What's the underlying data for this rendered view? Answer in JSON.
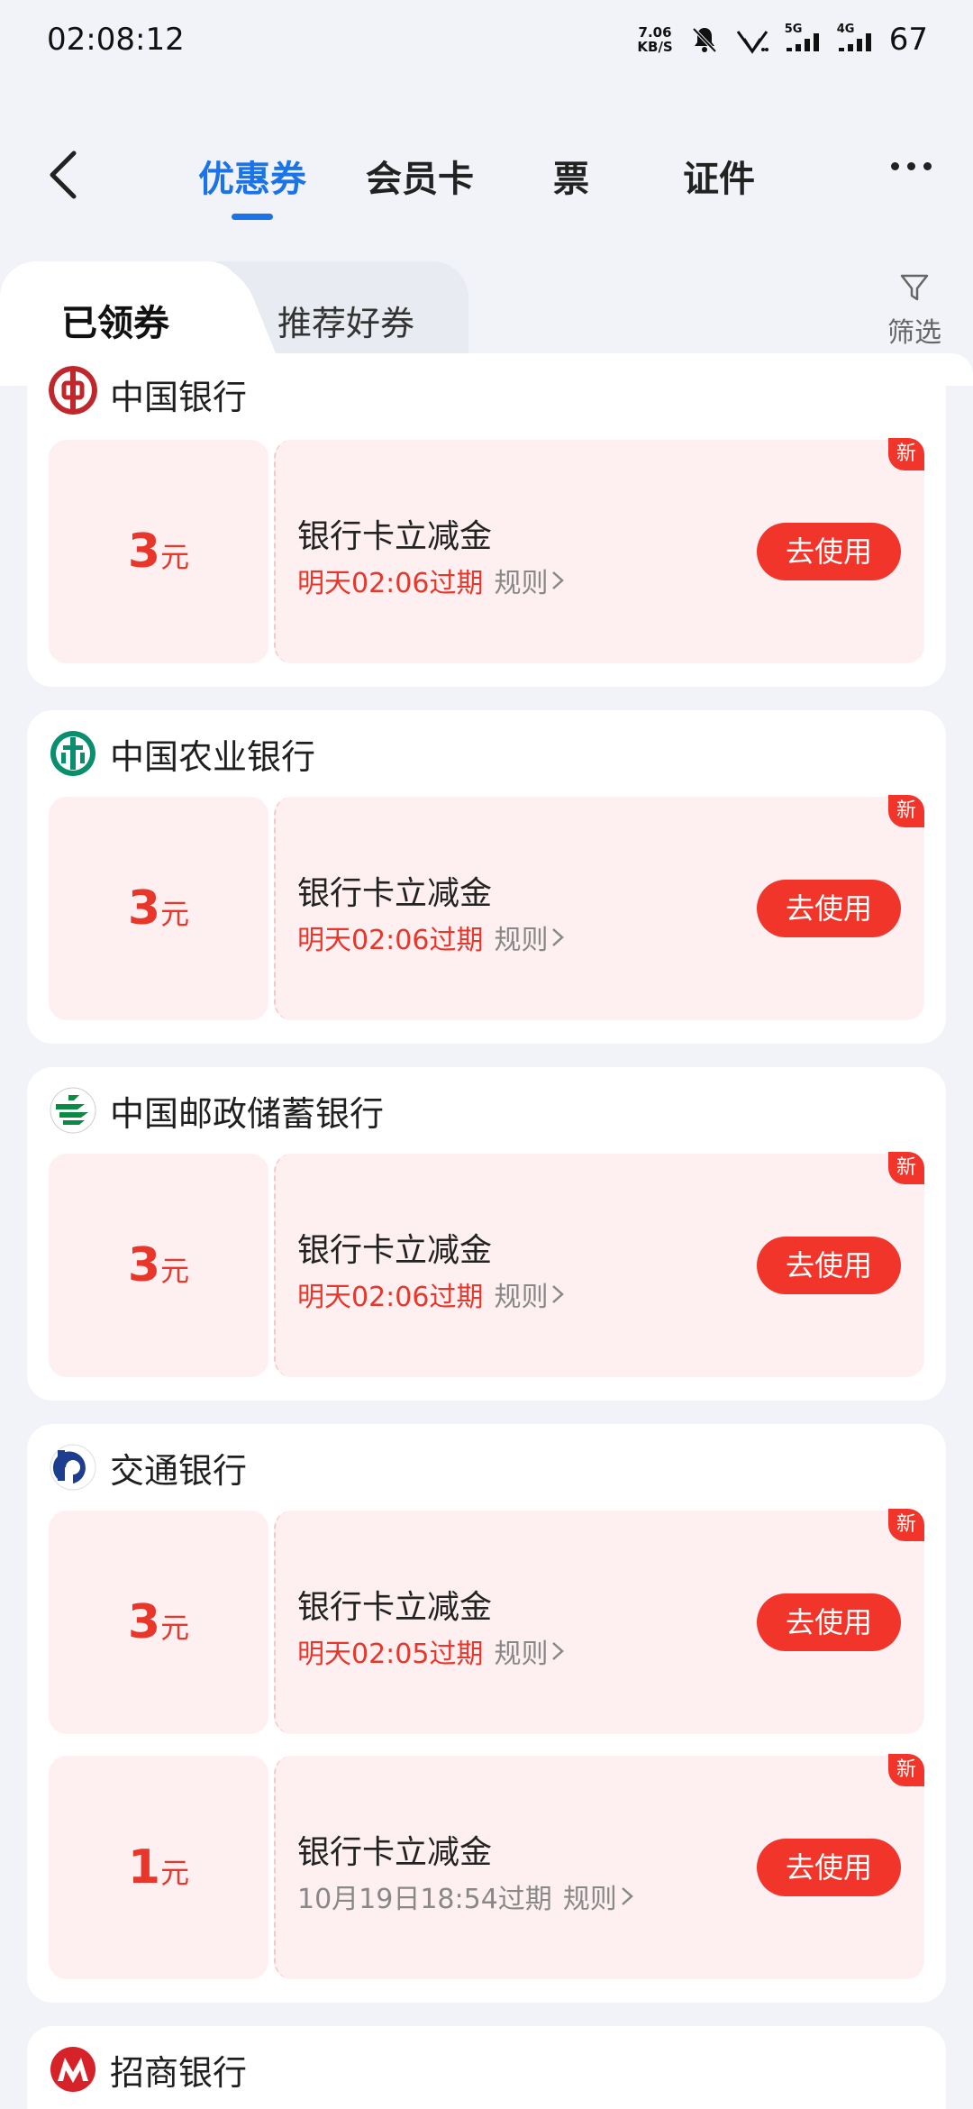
{
  "status_bar": {
    "time": "02:08:12",
    "net_speed_value": "7.06",
    "net_speed_unit": "KB/S",
    "sig1_label": "5G",
    "sig2_label": "4G",
    "battery": "67"
  },
  "header": {
    "tabs": [
      "优惠券",
      "会员卡",
      "票",
      "证件"
    ],
    "active_tab": "优惠券"
  },
  "sub_tabs": {
    "active": "已领券",
    "inactive": "推荐好券",
    "filter_label": "筛选"
  },
  "banks": [
    {
      "name": "中国银行",
      "logo": "boc-logo",
      "coupons": [
        {
          "amount": "3",
          "unit": "元",
          "title": "银行卡立减金",
          "expire": "明天02:06过期",
          "rule": "规则",
          "button": "去使用",
          "badge": "新",
          "expire_color": "red"
        }
      ]
    },
    {
      "name": "中国农业银行",
      "logo": "abc-logo",
      "coupons": [
        {
          "amount": "3",
          "unit": "元",
          "title": "银行卡立减金",
          "expire": "明天02:06过期",
          "rule": "规则",
          "button": "去使用",
          "badge": "新",
          "expire_color": "red"
        }
      ]
    },
    {
      "name": "中国邮政储蓄银行",
      "logo": "psbc-logo",
      "coupons": [
        {
          "amount": "3",
          "unit": "元",
          "title": "银行卡立减金",
          "expire": "明天02:06过期",
          "rule": "规则",
          "button": "去使用",
          "badge": "新",
          "expire_color": "red"
        }
      ]
    },
    {
      "name": "交通银行",
      "logo": "bocom-logo",
      "coupons": [
        {
          "amount": "3",
          "unit": "元",
          "title": "银行卡立减金",
          "expire": "明天02:05过期",
          "rule": "规则",
          "button": "去使用",
          "badge": "新",
          "expire_color": "red"
        },
        {
          "amount": "1",
          "unit": "元",
          "title": "银行卡立减金",
          "expire": "10月19日18:54过期",
          "rule": "规则",
          "button": "去使用",
          "badge": "新",
          "expire_color": "grey"
        }
      ]
    },
    {
      "name": "招商银行",
      "logo": "cmb-logo",
      "coupons": []
    }
  ],
  "colors": {
    "accent_blue": "#1a73e8",
    "coupon_red": "#e9362b",
    "coupon_bg": "#feeff1",
    "page_bg": "#f1f3f8"
  }
}
